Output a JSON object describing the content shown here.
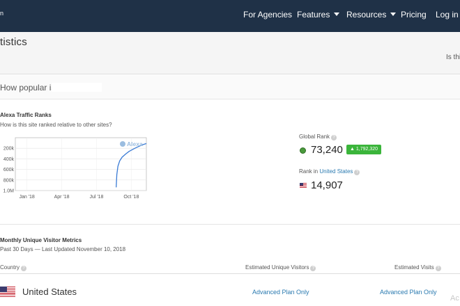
{
  "nav": {
    "brand_fragment": "n",
    "items": [
      {
        "label": "For Agencies",
        "dropdown": false
      },
      {
        "label": "Features",
        "dropdown": true
      },
      {
        "label": "Resources",
        "dropdown": true
      },
      {
        "label": "Pricing",
        "dropdown": false
      },
      {
        "label": "Log in",
        "dropdown": false
      }
    ]
  },
  "header": {
    "title": "tistics",
    "right_text": "Is thi"
  },
  "search": {
    "question": "How popular is"
  },
  "traffic": {
    "title": "Alexa Traffic Ranks",
    "subtitle": "How is this site ranked relative to other sites?",
    "global_rank_label": "Global Rank",
    "global_rank_value": "73,240",
    "global_delta": "1,792,320",
    "country_rank_prefix": "Rank in",
    "country_rank_link": "United States",
    "country_rank_value": "14,907"
  },
  "chart_data": {
    "type": "line",
    "title": "",
    "xlabel": "",
    "ylabel": "",
    "watermark": "Alexa",
    "x_tick_labels": [
      "Jan '18",
      "Apr '18",
      "Jul '18",
      "Oct '18"
    ],
    "y_tick_labels": [
      "200k",
      "400k",
      "600k",
      "800k",
      "1.0M"
    ],
    "y_tick_values": [
      200000,
      400000,
      600000,
      800000,
      1000000
    ],
    "ylim": [
      0,
      1000000
    ],
    "y_inverted": true,
    "xlim": [
      0,
      11.3
    ],
    "grid": true,
    "series": [
      {
        "name": "",
        "color": "#3a7bd5",
        "x": [
          8.7,
          8.75,
          8.85,
          9.0,
          9.2,
          9.5,
          9.8,
          10.1,
          10.4,
          10.7,
          11.0,
          11.3
        ],
        "y": [
          940000,
          700000,
          540000,
          440000,
          370000,
          310000,
          260000,
          225000,
          190000,
          160000,
          132000,
          110000
        ]
      }
    ]
  },
  "visitors": {
    "title": "Monthly Unique Visitor Metrics",
    "subtitle": "Past 30 Days — Last Updated November 10, 2018",
    "columns": [
      "Country",
      "Estimated Unique Visitors",
      "Estimated Visits"
    ],
    "rows": [
      {
        "country": "United States",
        "unique_visitors": "Advanced Plan Only",
        "visits": "Advanced Plan Only"
      }
    ]
  },
  "watermark_text": "Ac",
  "colors": {
    "nav_bg": "#1f3147",
    "link": "#2a7ab0",
    "delta_badge": "#3bb53b",
    "chart_line": "#3a7bd5"
  },
  "icons": {
    "help": "question-circle-icon",
    "globe": "globe-icon",
    "flag": "us-flag-icon",
    "caret": "caret-down-icon"
  }
}
